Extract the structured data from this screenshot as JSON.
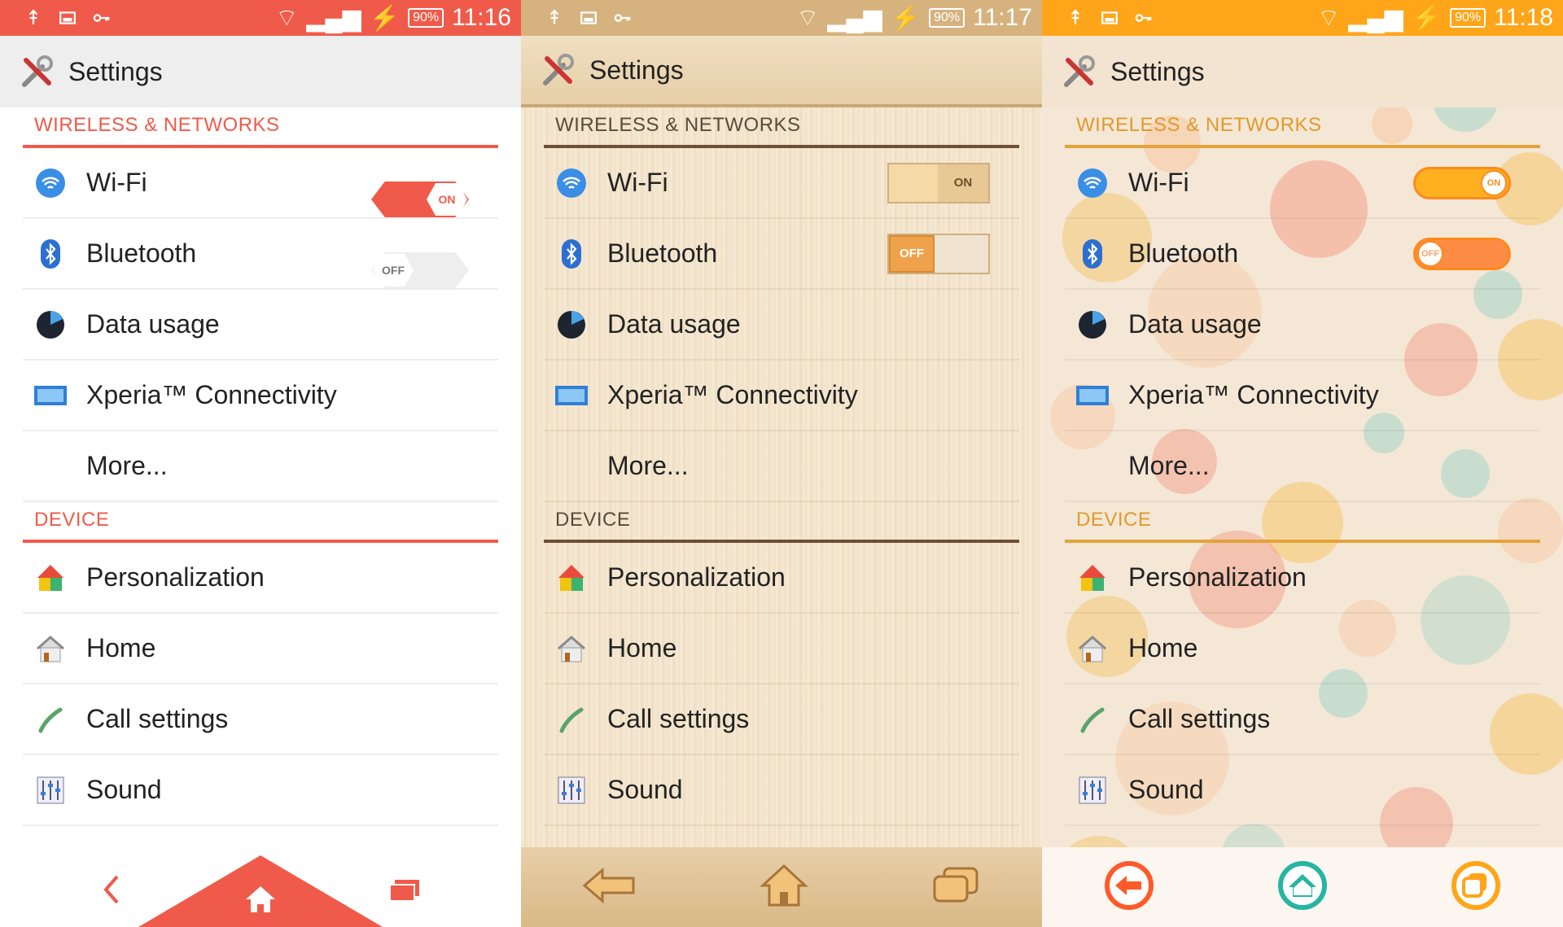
{
  "panels": [
    {
      "theme": "red",
      "status": {
        "battery": "90%",
        "time": "11:16"
      },
      "title": "Settings",
      "sections": [
        {
          "header": "WIRELESS & NETWORKS"
        },
        {
          "header": "DEVICE"
        }
      ],
      "rows": {
        "wifi": "Wi-Fi",
        "bluetooth": "Bluetooth",
        "data": "Data usage",
        "xperia": "Xperia™ Connectivity",
        "more": "More...",
        "personalization": "Personalization",
        "home": "Home",
        "call": "Call settings",
        "sound": "Sound"
      },
      "toggles": {
        "wifi": "ON",
        "bluetooth": "OFF"
      },
      "accent": "#f05a4a"
    },
    {
      "theme": "wood",
      "status": {
        "battery": "90%",
        "time": "11:17"
      },
      "title": "Settings",
      "sections": [
        {
          "header": "WIRELESS & NETWORKS"
        },
        {
          "header": "DEVICE"
        }
      ],
      "rows": {
        "wifi": "Wi-Fi",
        "bluetooth": "Bluetooth",
        "data": "Data usage",
        "xperia": "Xperia™ Connectivity",
        "more": "More...",
        "personalization": "Personalization",
        "home": "Home",
        "call": "Call settings",
        "sound": "Sound"
      },
      "toggles": {
        "wifi": "ON",
        "bluetooth": "OFF"
      },
      "accent": "#d6b27f"
    },
    {
      "theme": "bubbles",
      "status": {
        "battery": "90%",
        "time": "11:18"
      },
      "title": "Settings",
      "sections": [
        {
          "header": "WIRELESS & NETWORKS"
        },
        {
          "header": "DEVICE"
        }
      ],
      "rows": {
        "wifi": "Wi-Fi",
        "bluetooth": "Bluetooth",
        "data": "Data usage",
        "xperia": "Xperia™ Connectivity",
        "more": "More...",
        "personalization": "Personalization",
        "home": "Home",
        "call": "Call settings",
        "sound": "Sound"
      },
      "toggles": {
        "wifi": "ON",
        "bluetooth": "OFF"
      },
      "accent": "#ffa51a"
    }
  ]
}
